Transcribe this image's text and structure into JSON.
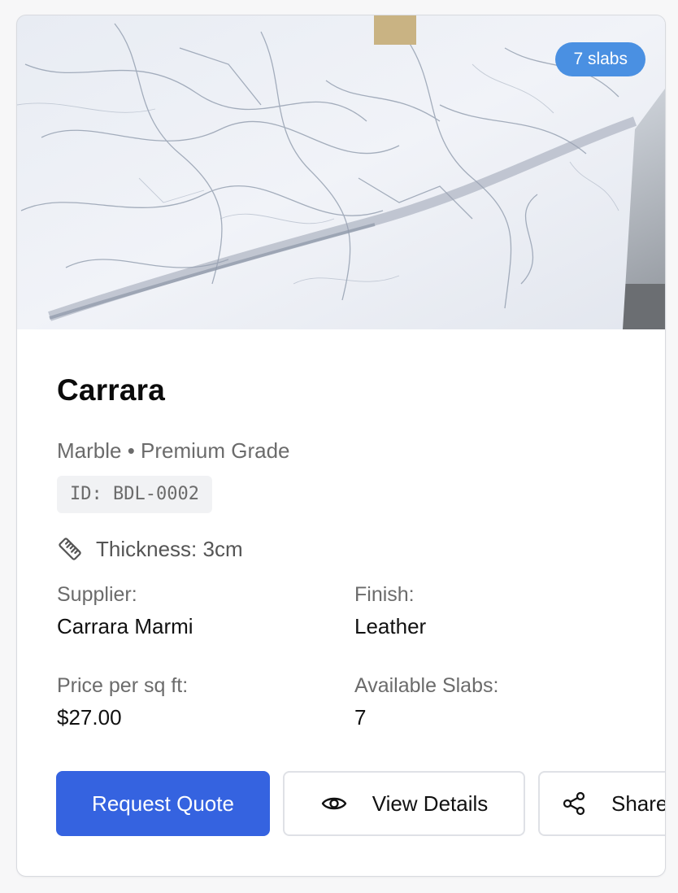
{
  "listing": {
    "badge": "7 slabs",
    "title": "Carrara",
    "subtitle": "Marble • Premium Grade",
    "id_text": "ID: BDL-0002",
    "thickness": "Thickness: 3cm",
    "details": {
      "supplier_label": "Supplier:",
      "supplier_value": "Carrara Marmi",
      "finish_label": "Finish:",
      "finish_value": "Leather",
      "price_label": "Price per sq ft:",
      "price_value": "$27.00",
      "slabs_label": "Available Slabs:",
      "slabs_value": "7"
    }
  },
  "actions": {
    "request_quote": "Request Quote",
    "view_details": "View Details",
    "share": "Share"
  },
  "icons": {
    "thickness": "ruler-icon",
    "view_details": "eye-icon",
    "share": "share-icon"
  },
  "colors": {
    "primary": "#3563e0",
    "badge": "#4a90e2"
  }
}
